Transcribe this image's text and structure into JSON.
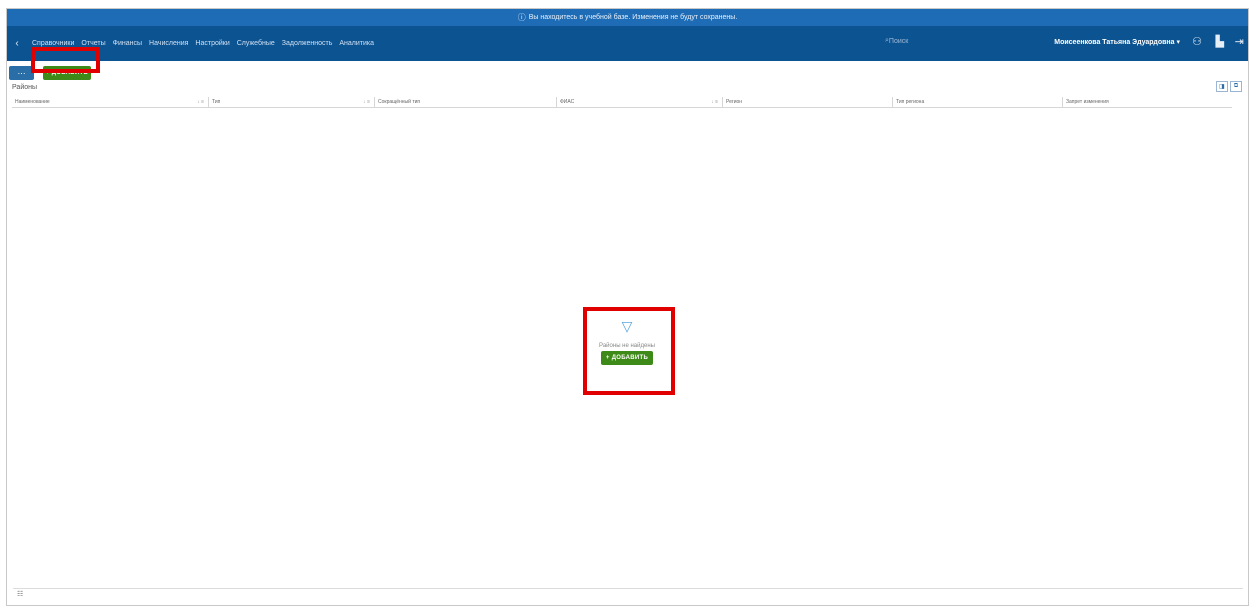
{
  "notice": {
    "text": "Вы находитесь в учебной базе. Изменения не будут сохранены.",
    "icon": "info-icon"
  },
  "topnav": {
    "items": [
      "Справочники",
      "Отчеты",
      "Финансы",
      "Начисления",
      "Настройки",
      "Служебные",
      "Задолженность",
      "Аналитика"
    ],
    "search_placeholder": "Поиск",
    "user": "Моисеенкова Татьяна Эдуардовна ▾"
  },
  "toolbar": {
    "menu_label": "⋯",
    "add_label": "+ ДОБАВИТЬ"
  },
  "page": {
    "title": "Районы"
  },
  "table": {
    "columns": [
      {
        "label": "Наименование",
        "sort": "↓ ≡"
      },
      {
        "label": "Тип",
        "sort": "↓ ≡"
      },
      {
        "label": "Сокращённый тип",
        "sort": ""
      },
      {
        "label": "ФИАС",
        "sort": "↓ ≡"
      },
      {
        "label": "Регион",
        "sort": ""
      },
      {
        "label": "Тип региона",
        "sort": ""
      },
      {
        "label": "Запрет изменения",
        "sort": ""
      }
    ]
  },
  "empty_state": {
    "text": "Районы не найдены",
    "add_label": "+ ДОБАВИТЬ"
  },
  "footer": {
    "icon_label": "☷"
  },
  "colors": {
    "notice": "#1f6cb6",
    "nav": "#0c5391",
    "add_button": "#3e8a18",
    "highlight": "#e00000"
  }
}
